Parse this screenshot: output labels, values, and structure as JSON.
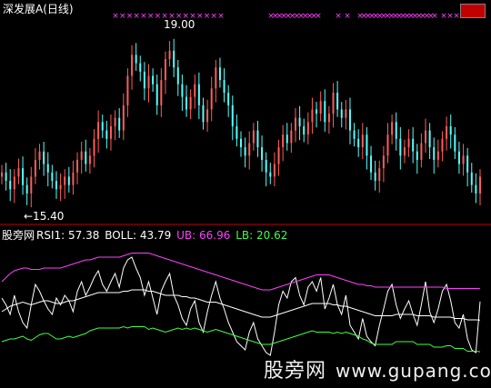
{
  "header": {
    "title": "深发展A",
    "period": "(日线)"
  },
  "indicator_header": {
    "site": "股旁网",
    "rsi_label": "RSI1:",
    "rsi_value": "57.38",
    "boll_label": "BOLL:",
    "boll_value": "43.79",
    "ub_label": "UB:",
    "ub_value": "66.96",
    "lb_label": "LB:",
    "lb_value": "20.62"
  },
  "watermark": {
    "cn": "股旁网",
    "url": "www.gupang.com"
  },
  "colors": {
    "background": "#000000",
    "up": "#ff5c5c",
    "down": "#55ffff",
    "separator": "#c00000",
    "rsi": "#ffffff",
    "boll": "#ffffff",
    "ub": "#ff40ff",
    "lb": "#40ff40",
    "signal": "#ff40ff",
    "text_white": "#ffffff",
    "ub_text": "#ff40ff",
    "lb_text": "#40ff40",
    "title_text": "#ffffff"
  },
  "chart_data": {
    "type": "candlestick",
    "price_panel": {
      "ylim": [
        15.0,
        19.5
      ],
      "high_annotation": "19.00",
      "low_annotation": "←15.40",
      "ohlc_closes": [
        16.0,
        15.8,
        15.6,
        15.9,
        16.1,
        15.7,
        15.5,
        15.9,
        16.3,
        16.5,
        16.2,
        16.0,
        15.8,
        15.6,
        15.7,
        15.9,
        15.7,
        16.0,
        16.3,
        16.5,
        16.2,
        16.4,
        16.8,
        17.2,
        17.0,
        16.8,
        17.1,
        17.3,
        17.0,
        17.6,
        18.3,
        18.8,
        18.6,
        18.4,
        18.0,
        18.3,
        18.1,
        17.6,
        18.2,
        18.7,
        18.9,
        18.5,
        18.1,
        17.8,
        17.5,
        17.8,
        18.1,
        17.6,
        17.2,
        17.5,
        18.0,
        18.5,
        18.2,
        17.9,
        17.6,
        17.1,
        16.8,
        16.6,
        16.4,
        16.7,
        17.0,
        16.6,
        16.3,
        16.0,
        15.9,
        16.2,
        16.6,
        16.9,
        16.7,
        17.0,
        17.3,
        17.1,
        16.9,
        17.2,
        17.5,
        17.4,
        17.7,
        17.2,
        17.4,
        17.9,
        17.5,
        17.3,
        17.5,
        17.0,
        16.8,
        16.6,
        16.9,
        16.4,
        16.0,
        15.8,
        16.1,
        16.4,
        16.9,
        17.2,
        16.8,
        16.4,
        16.6,
        16.8,
        16.5,
        16.3,
        16.7,
        17.0,
        16.6,
        16.3,
        16.5,
        16.8,
        17.1,
        16.9,
        16.5,
        16.2,
        16.4,
        16.0,
        15.7,
        15.5,
        15.9
      ]
    },
    "indicator_panel": {
      "ylim": [
        0,
        100
      ],
      "series": [
        {
          "name": "RSI1",
          "values": [
            60,
            55,
            48,
            62,
            50,
            42,
            38,
            55,
            70,
            65,
            58,
            52,
            48,
            60,
            55,
            62,
            58,
            50,
            65,
            72,
            62,
            68,
            75,
            80,
            70,
            65,
            72,
            78,
            68,
            82,
            88,
            90,
            82,
            75,
            62,
            72,
            60,
            48,
            65,
            72,
            78,
            62,
            55,
            45,
            40,
            52,
            58,
            42,
            35,
            50,
            62,
            72,
            60,
            52,
            42,
            35,
            28,
            25,
            22,
            35,
            42,
            30,
            25,
            20,
            18,
            35,
            55,
            65,
            60,
            72,
            75,
            62,
            55,
            68,
            72,
            65,
            75,
            52,
            60,
            70,
            55,
            48,
            62,
            40,
            35,
            30,
            45,
            32,
            28,
            25,
            40,
            52,
            65,
            70,
            55,
            45,
            52,
            58,
            48,
            40,
            55,
            72,
            50,
            42,
            52,
            65,
            70,
            58,
            42,
            38,
            48,
            30,
            22,
            20,
            57.38
          ]
        },
        {
          "name": "BOLL",
          "values": [
            50,
            52,
            54,
            55,
            56,
            57,
            56,
            55,
            56,
            57,
            58,
            58,
            57,
            56,
            56,
            57,
            58,
            58,
            59,
            60,
            61,
            62,
            63,
            64,
            64,
            64,
            64,
            64,
            64,
            65,
            65,
            66,
            66,
            66,
            66,
            65,
            65,
            64,
            63,
            62,
            62,
            62,
            62,
            61,
            61,
            60,
            60,
            59,
            58,
            57,
            57,
            57,
            56,
            55,
            54,
            53,
            52,
            51,
            50,
            49,
            48,
            47,
            46,
            46,
            46,
            47,
            48,
            49,
            50,
            51,
            52,
            53,
            54,
            55,
            56,
            56,
            56,
            56,
            56,
            55,
            55,
            54,
            54,
            53,
            52,
            51,
            50,
            49,
            48,
            47,
            47,
            47,
            47,
            47,
            48,
            48,
            48,
            48,
            48,
            47,
            47,
            47,
            47,
            46,
            46,
            46,
            46,
            46,
            45,
            45,
            45,
            44,
            44,
            44,
            43.79
          ]
        },
        {
          "name": "UB",
          "values": [
            72,
            75,
            78,
            80,
            81,
            82,
            82,
            81,
            81,
            81,
            82,
            82,
            82,
            82,
            82,
            83,
            84,
            85,
            86,
            87,
            88,
            88,
            89,
            90,
            90,
            90,
            90,
            90,
            90,
            91,
            92,
            93,
            93,
            93,
            93,
            93,
            92,
            91,
            90,
            89,
            88,
            87,
            86,
            85,
            84,
            83,
            82,
            81,
            80,
            79,
            78,
            77,
            76,
            75,
            74,
            73,
            72,
            71,
            70,
            69,
            68,
            67,
            66,
            66,
            66,
            67,
            68,
            69,
            70,
            71,
            72,
            73,
            74,
            75,
            76,
            77,
            77,
            77,
            77,
            76,
            75,
            74,
            73,
            72,
            71,
            70,
            70,
            69,
            69,
            68,
            68,
            68,
            68,
            68,
            68,
            68,
            68,
            68,
            68,
            68,
            68,
            68,
            68,
            68,
            68,
            68,
            67,
            67,
            67,
            67,
            67,
            67,
            67,
            67,
            66.96
          ]
        },
        {
          "name": "LB",
          "values": [
            28,
            29,
            30,
            30,
            31,
            32,
            30,
            29,
            31,
            33,
            34,
            34,
            32,
            30,
            30,
            31,
            32,
            31,
            32,
            33,
            34,
            36,
            37,
            38,
            38,
            38,
            38,
            38,
            38,
            39,
            38,
            39,
            39,
            39,
            39,
            37,
            38,
            37,
            36,
            35,
            36,
            37,
            38,
            37,
            38,
            37,
            38,
            37,
            36,
            35,
            36,
            37,
            36,
            35,
            34,
            33,
            32,
            31,
            30,
            29,
            28,
            27,
            26,
            26,
            26,
            27,
            28,
            29,
            30,
            31,
            32,
            33,
            34,
            35,
            36,
            35,
            35,
            35,
            35,
            34,
            35,
            34,
            35,
            34,
            33,
            32,
            30,
            29,
            27,
            26,
            26,
            26,
            26,
            26,
            28,
            28,
            28,
            28,
            28,
            26,
            26,
            26,
            26,
            24,
            24,
            24,
            25,
            25,
            23,
            23,
            23,
            21,
            21,
            21,
            20.62
          ]
        }
      ]
    },
    "signals": {
      "marker": "×",
      "groups": [
        {
          "start": 127,
          "end": 243,
          "count": 16
        },
        {
          "start": 298,
          "end": 350,
          "count": 12
        },
        {
          "start": 372,
          "end": 382,
          "count": 2
        },
        {
          "start": 396,
          "end": 478,
          "count": 20
        },
        {
          "start": 488,
          "end": 502,
          "count": 3
        }
      ]
    }
  }
}
